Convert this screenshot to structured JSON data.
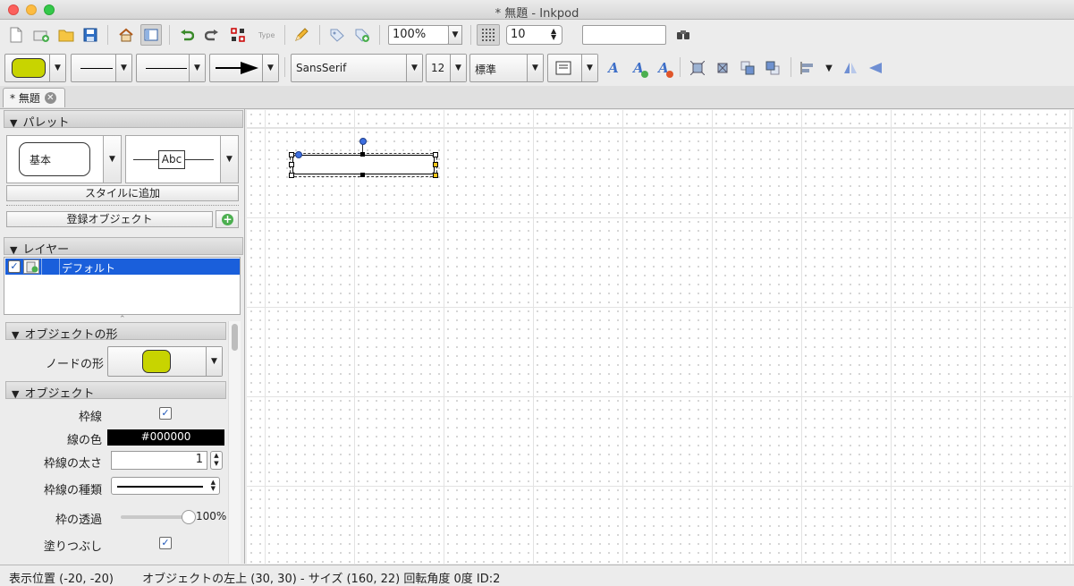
{
  "window": {
    "title": "* 無題 - Inkpod"
  },
  "toolbar": {
    "type_label": "Type",
    "zoom_value": "100%",
    "grid_size": "10",
    "search_value": ""
  },
  "format_bar": {
    "font_name": "SansSerif",
    "font_size": "12",
    "font_style": "標準",
    "fill_color": "#c8d400"
  },
  "tab": {
    "label": "* 無題"
  },
  "palette": {
    "header": "パレット",
    "item_basic_label": "基本",
    "item_abc_label": "Abc",
    "add_style_button": "スタイルに追加",
    "registered_objects_button": "登録オブジェクト"
  },
  "layers": {
    "header": "レイヤー",
    "rows": [
      {
        "name": "デフォルト",
        "visible": true
      }
    ]
  },
  "object_shape": {
    "header": "オブジェクトの形",
    "node_shape_label": "ノードの形",
    "node_color": "#c8d400"
  },
  "object": {
    "header": "オブジェクト",
    "border_label": "枠線",
    "border_checked": true,
    "line_color_label": "線の色",
    "line_color_value": "#000000",
    "line_width_label": "枠線の太さ",
    "line_width_value": "1",
    "line_type_label": "枠線の種類",
    "opacity_label": "枠の透過",
    "opacity_value": "100%",
    "opacity_level": 1.0,
    "fill_label": "塗りつぶし",
    "fill_checked": true
  },
  "status": {
    "position": "表示位置 (-20, -20)",
    "object_info": "オブジェクトの左上 (30, 30) - サイズ (160, 22) 回転角度 0度 ID:2"
  }
}
